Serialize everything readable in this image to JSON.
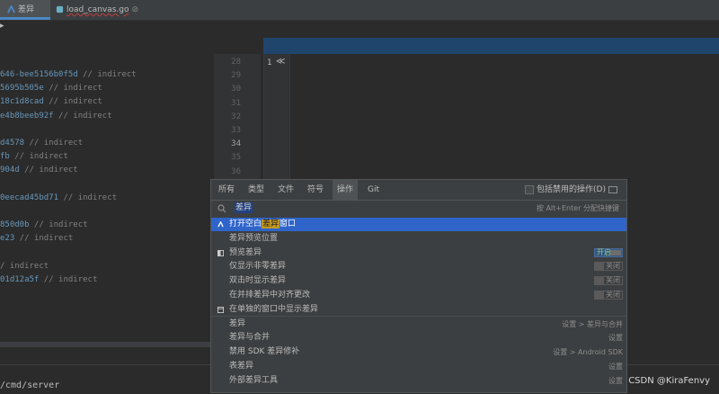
{
  "tabs": [
    {
      "label": "差异",
      "active": true
    },
    {
      "label": "load_canvas.go",
      "closable_glyph": "⊘"
    }
  ],
  "code_lines": [
    {
      "hash": "646-bee5156b0f5d",
      "comment": " // indirect"
    },
    {
      "hash": "5695b505e",
      "comment": " // indirect"
    },
    {
      "hash": "18c1d8cad",
      "comment": " // indirect"
    },
    {
      "hash": "e4b8beeb92f",
      "comment": " // indirect"
    },
    {
      "hash": "",
      "comment": ""
    },
    {
      "hash": "d4578",
      "comment": " // indirect"
    },
    {
      "hash": "fb",
      "comment": " // indirect"
    },
    {
      "hash": "904d",
      "comment": " // indirect"
    },
    {
      "hash": "",
      "comment": ""
    },
    {
      "hash": "0eecad45bd71",
      "comment": " // indirect"
    },
    {
      "hash": "",
      "comment": ""
    },
    {
      "hash": "850d0b",
      "comment": " // indirect"
    },
    {
      "hash": "e23",
      "comment": " // indirect"
    },
    {
      "hash": "",
      "comment": ""
    },
    {
      "hash": "",
      "comment": "/ indirect"
    },
    {
      "hash": "01d12a5f",
      "comment": " // indirect"
    }
  ],
  "line_numbers": [
    "28",
    "29",
    "30",
    "31",
    "32",
    "33",
    "34",
    "35",
    "36"
  ],
  "right_line_number": "1",
  "right_fold_glyph": "≪",
  "terminal_text": "/cmd/server",
  "watermark": "CSDN @KiraFenvy",
  "popup": {
    "tabs": [
      "所有",
      "类型",
      "文件",
      "符号",
      "操作",
      "Git"
    ],
    "active_tab": "操作",
    "include_disabled_label": "包括禁用的操作(D)",
    "search_value": "差异",
    "search_hint": "按 Alt+Enter 分配快捷键",
    "rows": [
      {
        "pre": "打开空白",
        "match": "差异",
        "post": "窗口",
        "selected": true,
        "icon": "diff-icon"
      },
      {
        "pre": "差异预览位置",
        "match": "",
        "post": ""
      },
      {
        "pre": "预览差异",
        "match": "",
        "post": "",
        "icon": "panel-icon",
        "toggle": "开启"
      },
      {
        "pre": "仅显示非零差异",
        "match": "",
        "post": "",
        "toggle_off": "关闭"
      },
      {
        "pre": "双击时显示差异",
        "match": "",
        "post": "",
        "toggle_off": "关闭"
      },
      {
        "pre": "在并排差异中对齐更改",
        "match": "",
        "post": "",
        "toggle_off": "关闭"
      },
      {
        "pre": "在单独的窗口中显示差异",
        "match": "",
        "post": "",
        "icon": "window-icon"
      },
      {
        "pre": "差异",
        "match": "",
        "post": "",
        "right": "设置 > 差异与合并"
      },
      {
        "pre": "差异与合并",
        "match": "",
        "post": "",
        "right": "设置"
      },
      {
        "pre": "禁用 SDK 差异修补",
        "match": "",
        "post": "",
        "right": "设置 > Android SDK"
      },
      {
        "pre": "表差异",
        "match": "",
        "post": "",
        "right": "设置"
      },
      {
        "pre": "外部差异工具",
        "match": "",
        "post": "",
        "right": "设置"
      }
    ]
  },
  "colors": {
    "accent": "#2f65ca",
    "highlight": "#c59a21",
    "hash": "#6897bb",
    "comment": "#808080"
  }
}
